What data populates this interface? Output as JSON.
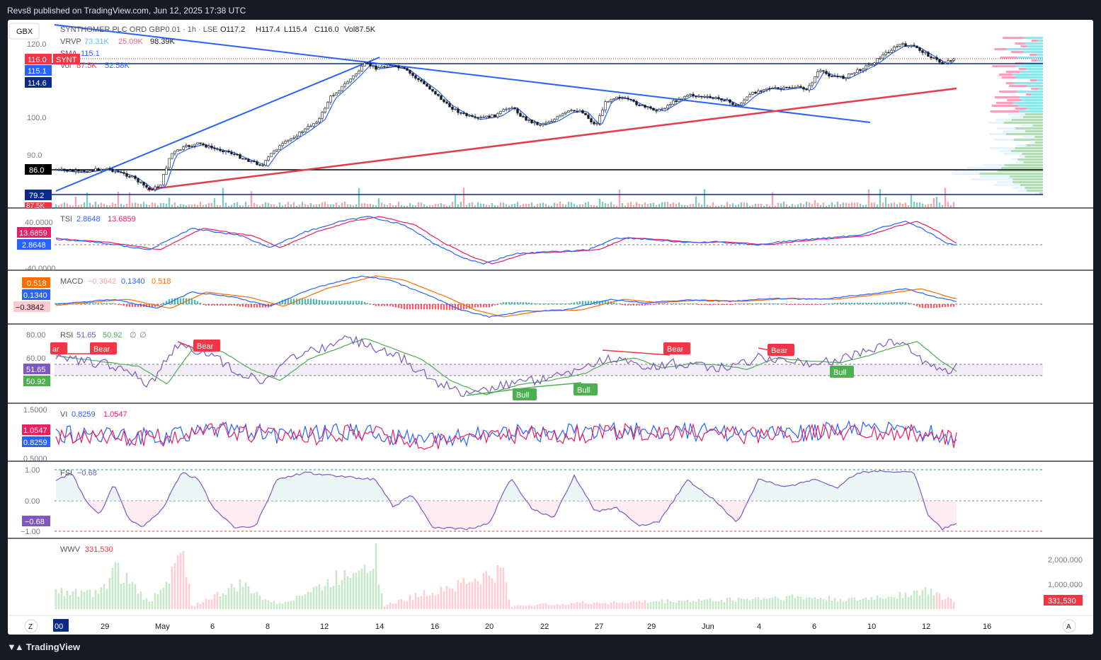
{
  "header": {
    "published": "Revs8 published on TradingView.com, Jun 12, 2025 17:38 UTC"
  },
  "footer": {
    "brand": "TradingView"
  },
  "main": {
    "currency_button": "GBX",
    "legend_symbol": "SYNTHOMER PLC ORD GBP0.01 · 1h · LSE",
    "legend_o": "O117.2",
    "legend_h": "H117.4",
    "legend_l": "L115.4",
    "legend_c": "C116.0",
    "legend_vol": "Vol87.5K",
    "vrvp_label": "VRVP",
    "vrvp_v1": "73.31K",
    "vrvp_v2": "25.09K",
    "vrvp_v3": "98.39K",
    "sma_label": "SMA",
    "sma_value": "115.1",
    "vol_label": "Vol",
    "vol_v1": "87.5K",
    "vol_v2": "52.58K",
    "price_ticks": [
      "120.0",
      "100.0",
      "90.0"
    ],
    "badges": [
      {
        "text": "116.0",
        "color": "#f23645"
      },
      {
        "text": "SYNT",
        "color": "#f23645"
      },
      {
        "text": "115.1",
        "color": "#2962ff"
      },
      {
        "text": "114.6",
        "color": "#0b2a8a"
      },
      {
        "text": "86.0",
        "color": "#000000"
      },
      {
        "text": "79.2",
        "color": "#0b2a8a"
      },
      {
        "text": "87.5K",
        "color": "#f23645"
      }
    ]
  },
  "indicators": {
    "tsi": {
      "label": "TSI",
      "v1": "2.8648",
      "v2": "13.6859",
      "top": "40.0000",
      "bottom": "-40.0000",
      "badge1": "13.6859",
      "badge2": "2.8648"
    },
    "macd": {
      "label": "MACD",
      "v1": "−0.3842",
      "v2": "0.1340",
      "v3": "0.518",
      "badge1": "0.518",
      "badge2": "0.1340",
      "badge3": "−0.3842"
    },
    "rsi": {
      "label": "RSI",
      "v1": "51.65",
      "v2": "50.92",
      "v3": "∅",
      "v4": "∅",
      "ticks": [
        "80.00",
        "60.00"
      ],
      "badge1": "51.65",
      "badge2": "50.92",
      "bear_labels": [
        "ar",
        "Bear",
        "Bear",
        "Bear",
        "Bear"
      ],
      "bull_labels": [
        "Bull",
        "Bull",
        "Bull"
      ]
    },
    "vi": {
      "label": "VI",
      "v1": "0.8259",
      "v2": "1.0547",
      "top": "1.5000",
      "bottom": "0.5000",
      "badge1": "1.0547",
      "badge2": "0.8259"
    },
    "fsi": {
      "label": "FSI",
      "v1": "−0.68",
      "ticks": [
        "1.00",
        "0.00",
        "−1.00"
      ],
      "badge": "−0.68"
    },
    "wwv": {
      "label": "WWV",
      "v1": "331,530",
      "ticks": [
        "2,000,000",
        "1,000,000"
      ],
      "badge": "331,530"
    }
  },
  "time_axis": {
    "labels": [
      "29",
      "May",
      "6",
      "8",
      "12",
      "14",
      "16",
      "20",
      "22",
      "27",
      "29",
      "Jun",
      "4",
      "6",
      "10",
      "12",
      "16"
    ],
    "left_button": "Z",
    "right_button": "A",
    "left_badge": "00"
  },
  "colors": {
    "up": "#089981",
    "down": "#f23645",
    "blue": "#2962ff",
    "red_trend": "#e8394a",
    "purple": "#7e57c2",
    "orange": "#ff9800",
    "green": "#4caf50"
  }
}
